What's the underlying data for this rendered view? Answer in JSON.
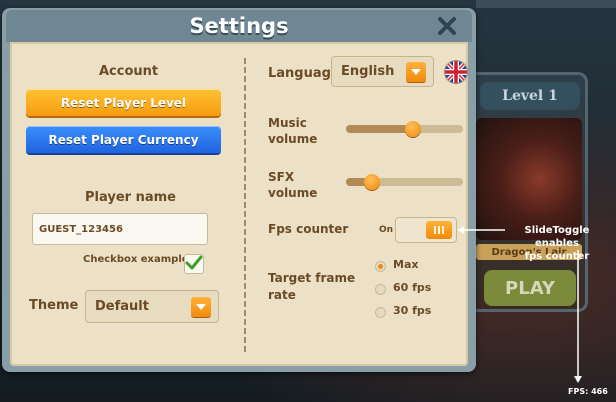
{
  "background": {
    "level_label": "Level 1",
    "caption": "Dragon's Lair",
    "play_label": "PLAY"
  },
  "dialog": {
    "title": "Settings"
  },
  "account": {
    "title": "Account",
    "reset_level_label": "Reset Player Level",
    "reset_currency_label": "Reset Player Currency"
  },
  "player": {
    "title": "Player name",
    "name_value": "GUEST_123456",
    "checkbox_label": "Checkbox example",
    "checkbox_checked": true
  },
  "theme": {
    "label": "Theme",
    "selected": "Default"
  },
  "language": {
    "label": "Language",
    "selected": "English",
    "flag": "uk-flag-icon"
  },
  "music": {
    "label_line1": "Music",
    "label_line2": "volume",
    "value": 0.57
  },
  "sfx": {
    "label_line1": "SFX",
    "label_line2": "volume",
    "value": 0.22
  },
  "fps": {
    "label": "Fps counter",
    "state_label": "On",
    "enabled": true
  },
  "target_frame_rate": {
    "label_line1": "Target frame",
    "label_line2": "rate",
    "options": [
      "Max",
      "60 fps",
      "30 fps"
    ],
    "selected_index": 0
  },
  "annotations": {
    "toggle_note_line1": "SlideToggle enables",
    "toggle_note_line2": "fps counter",
    "fps_readout": "FPS: 466"
  },
  "colors": {
    "accent_orange": "#f59c0f",
    "accent_blue": "#1f63e0",
    "panel": "#ece1c7",
    "text_brown": "#6b4a26"
  }
}
